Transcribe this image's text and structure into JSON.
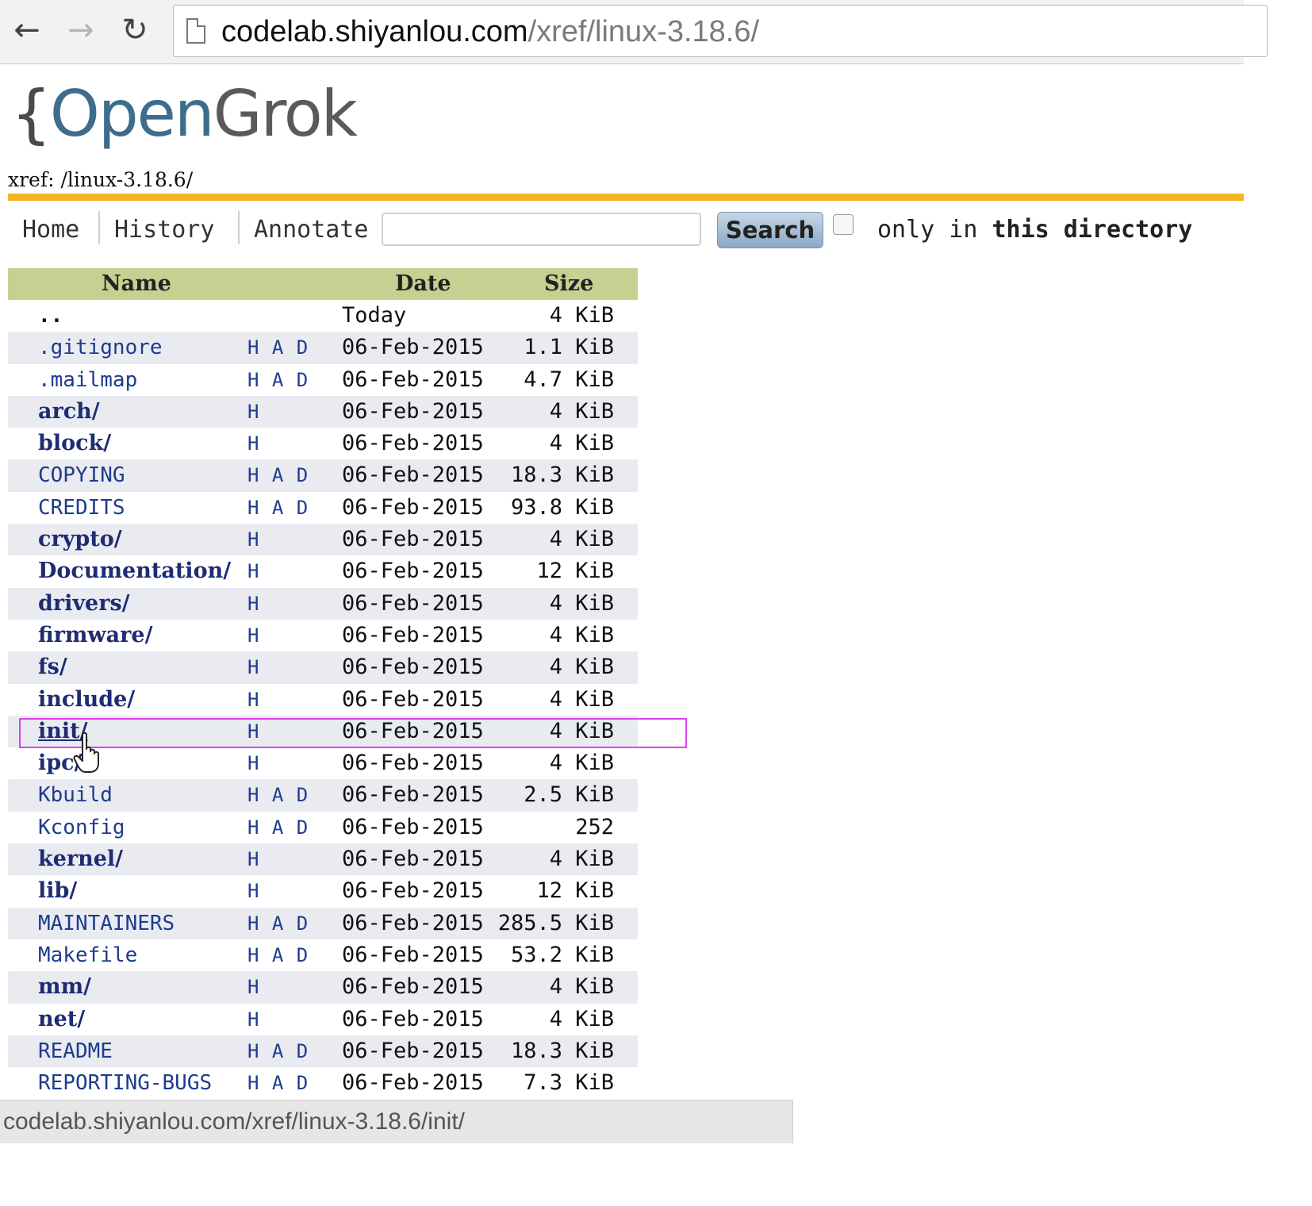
{
  "browser": {
    "back_icon": "back-arrow-icon",
    "forward_icon": "forward-arrow-icon",
    "reload_icon": "reload-icon",
    "url_host": "codelab.shiyanlou.com",
    "url_path": "/xref/linux-3.18.6/"
  },
  "logo": {
    "brace": "{",
    "open": "Open",
    "grok": "Grok"
  },
  "breadcrumb": "xref: /linux-3.18.6/",
  "menu": {
    "home": "Home",
    "history": "History",
    "annotate": "Annotate",
    "search_value": "",
    "search_button": "Search",
    "only_in_prefix": "only in ",
    "only_in_bold": "this directory"
  },
  "table": {
    "headers": {
      "name": "Name",
      "date": "Date",
      "size": "Size"
    },
    "rows": [
      {
        "name": "..",
        "links": "",
        "date": "Today",
        "size": "4 KiB"
      },
      {
        "name": ".gitignore",
        "links": "H A D",
        "date": "06-Feb-2015",
        "size": "1.1 KiB"
      },
      {
        "name": ".mailmap",
        "links": "H A D",
        "date": "06-Feb-2015",
        "size": "4.7 KiB"
      },
      {
        "name": "arch/",
        "links": "H",
        "date": "06-Feb-2015",
        "size": "4 KiB"
      },
      {
        "name": "block/",
        "links": "H",
        "date": "06-Feb-2015",
        "size": "4 KiB"
      },
      {
        "name": "COPYING",
        "links": "H A D",
        "date": "06-Feb-2015",
        "size": "18.3 KiB"
      },
      {
        "name": "CREDITS",
        "links": "H A D",
        "date": "06-Feb-2015",
        "size": "93.8 KiB"
      },
      {
        "name": "crypto/",
        "links": "H",
        "date": "06-Feb-2015",
        "size": "4 KiB"
      },
      {
        "name": "Documentation/",
        "links": "H",
        "date": "06-Feb-2015",
        "size": "12 KiB"
      },
      {
        "name": "drivers/",
        "links": "H",
        "date": "06-Feb-2015",
        "size": "4 KiB"
      },
      {
        "name": "firmware/",
        "links": "H",
        "date": "06-Feb-2015",
        "size": "4 KiB"
      },
      {
        "name": "fs/",
        "links": "H",
        "date": "06-Feb-2015",
        "size": "4 KiB"
      },
      {
        "name": "include/",
        "links": "H",
        "date": "06-Feb-2015",
        "size": "4 KiB"
      },
      {
        "name": "init/",
        "links": "H",
        "date": "06-Feb-2015",
        "size": "4 KiB"
      },
      {
        "name": "ipc/",
        "links": "H",
        "date": "06-Feb-2015",
        "size": "4 KiB"
      },
      {
        "name": "Kbuild",
        "links": "H A D",
        "date": "06-Feb-2015",
        "size": "2.5 KiB"
      },
      {
        "name": "Kconfig",
        "links": "H A D",
        "date": "06-Feb-2015",
        "size": "252"
      },
      {
        "name": "kernel/",
        "links": "H",
        "date": "06-Feb-2015",
        "size": "4 KiB"
      },
      {
        "name": "lib/",
        "links": "H",
        "date": "06-Feb-2015",
        "size": "12 KiB"
      },
      {
        "name": "MAINTAINERS",
        "links": "H A D",
        "date": "06-Feb-2015",
        "size": "285.5 KiB"
      },
      {
        "name": "Makefile",
        "links": "H A D",
        "date": "06-Feb-2015",
        "size": "53.2 KiB"
      },
      {
        "name": "mm/",
        "links": "H",
        "date": "06-Feb-2015",
        "size": "4 KiB"
      },
      {
        "name": "net/",
        "links": "H",
        "date": "06-Feb-2015",
        "size": "4 KiB"
      },
      {
        "name": "README",
        "links": "H A D",
        "date": "06-Feb-2015",
        "size": "18.3 KiB"
      },
      {
        "name": "REPORTING-BUGS",
        "links": "H A D",
        "date": "06-Feb-2015",
        "size": "7.3 KiB"
      }
    ]
  },
  "status_url": "codelab.shiyanlou.com/xref/linux-3.18.6/init/",
  "colors": {
    "header_bar": "#c7cf91",
    "gold_rule": "#f3b523",
    "alt_row": "#e9ebf1",
    "link_file": "#1e3c8c",
    "link_dir": "#1d2c73",
    "highlight_box": "#e23ff0",
    "logo_open": "#3c6d8c"
  }
}
